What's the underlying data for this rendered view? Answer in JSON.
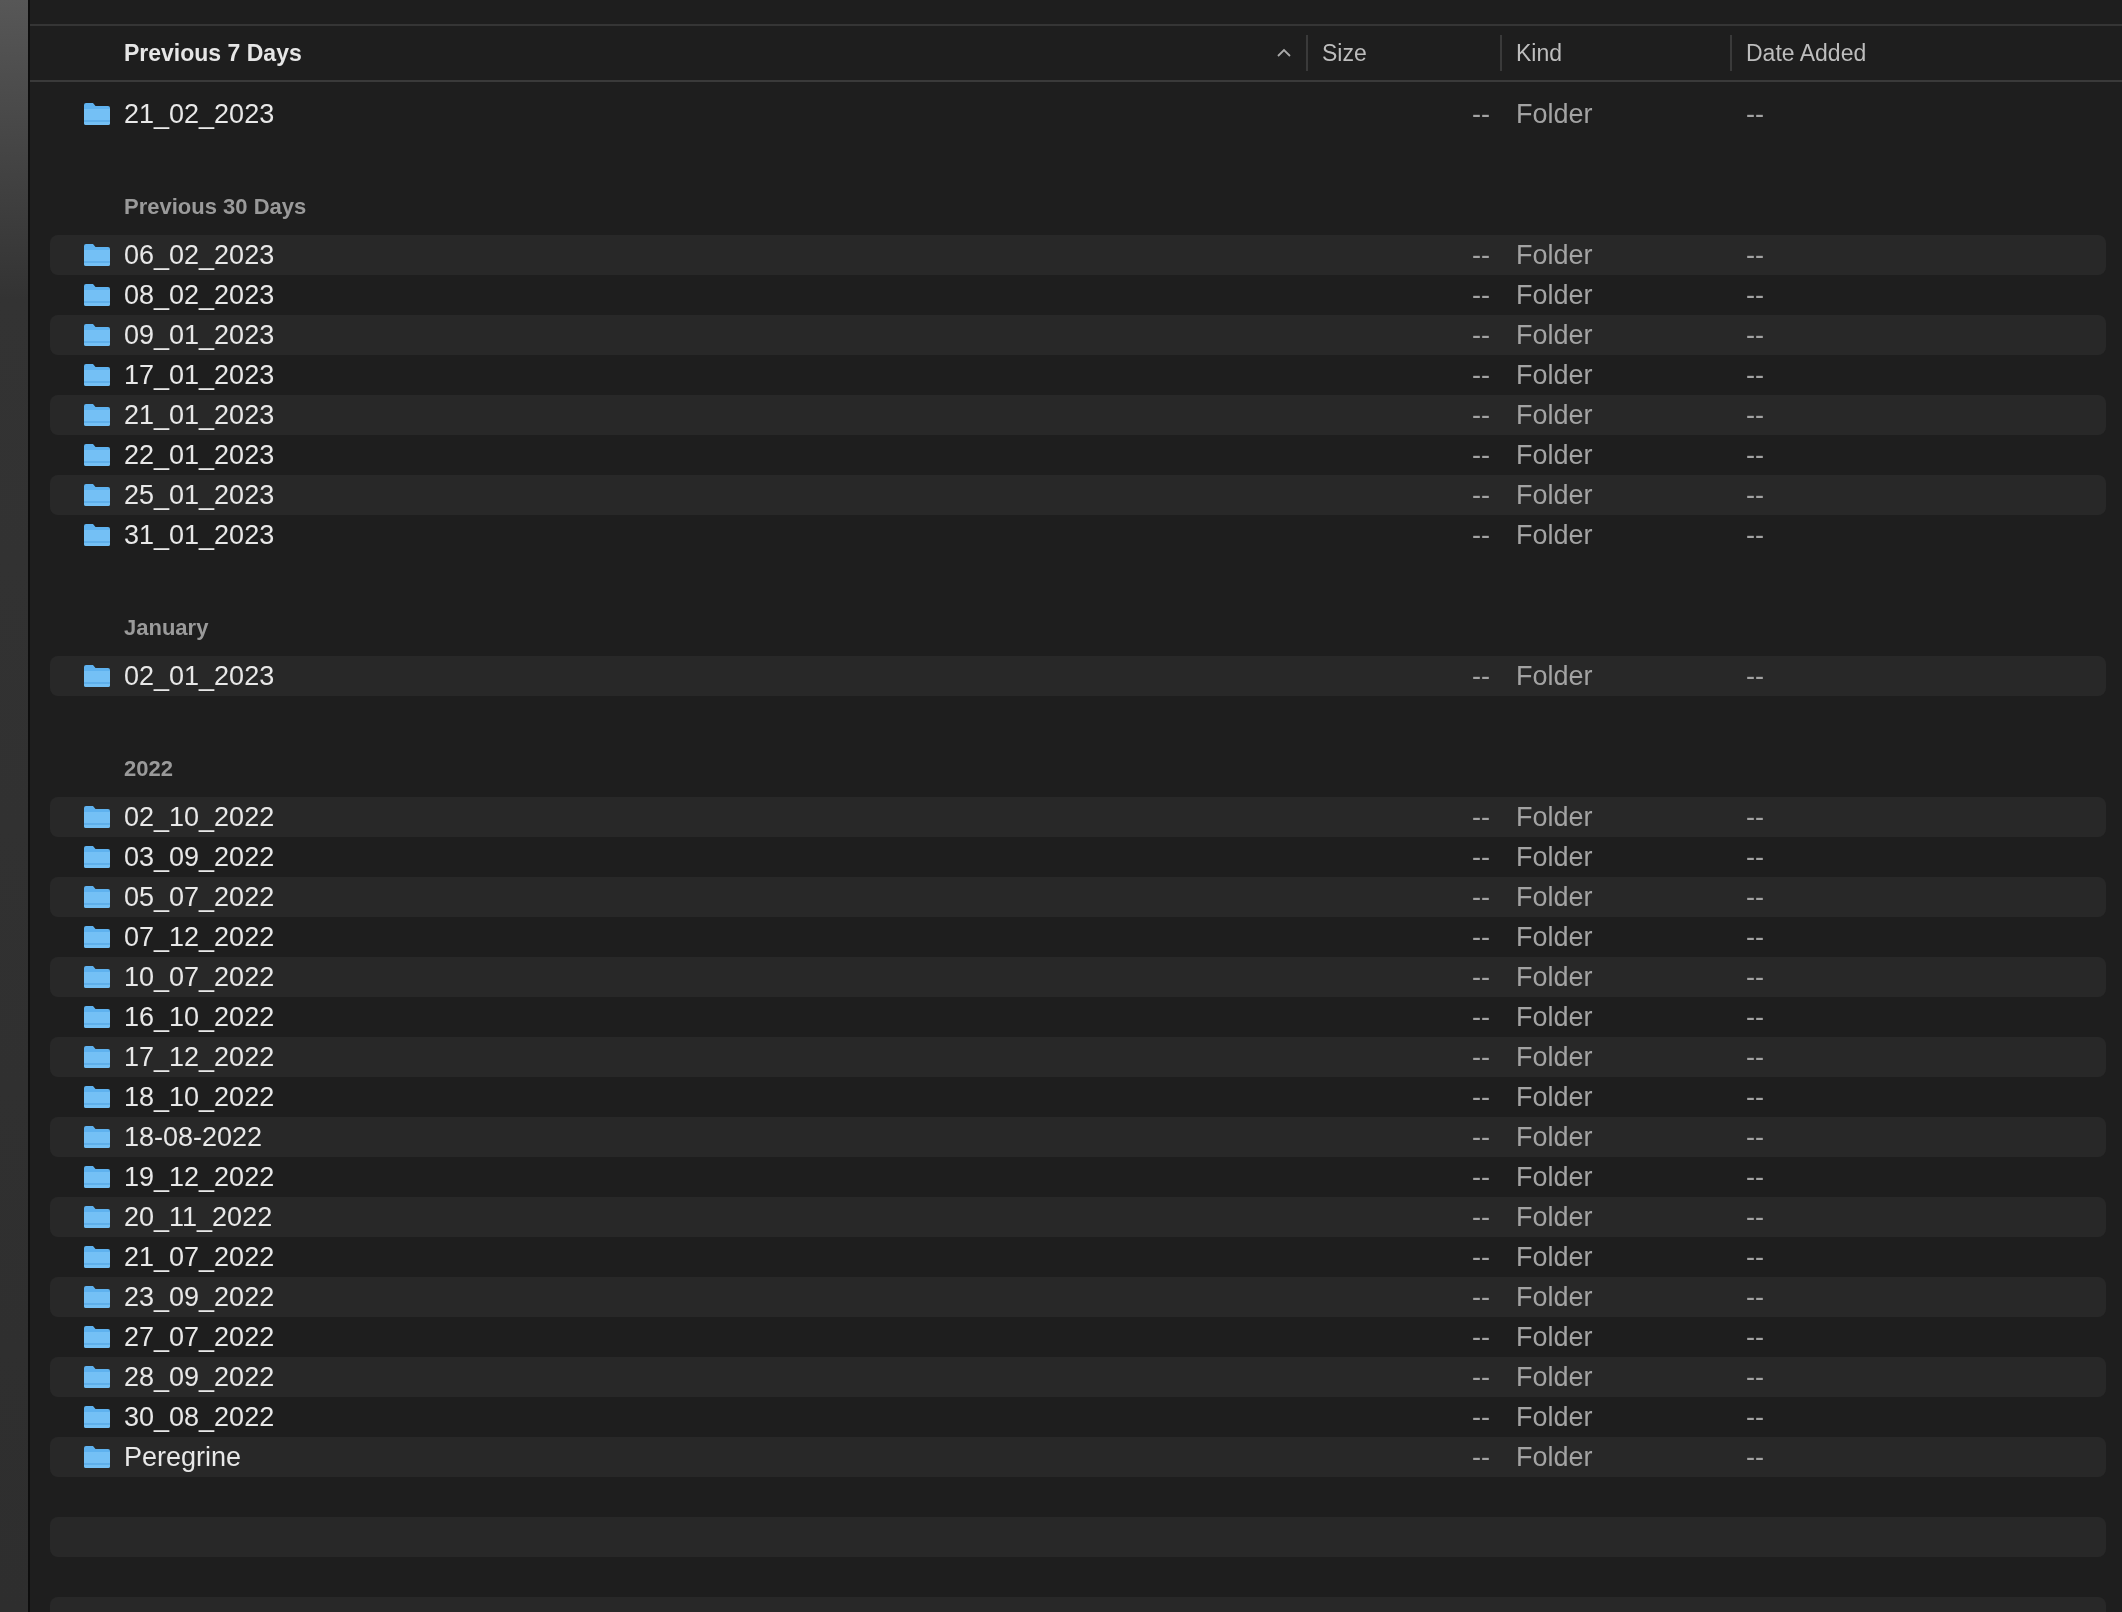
{
  "table": {
    "columns": [
      {
        "label": "Previous 7 Days",
        "sorted": true
      },
      {
        "label": "Size",
        "sorted": false
      },
      {
        "label": "Kind",
        "sorted": false
      },
      {
        "label": "Date Added",
        "sorted": false
      }
    ],
    "sections": [
      {
        "rows": [
          {
            "name": "21_02_2023",
            "size": "--",
            "kind": "Folder",
            "date_added": "--"
          }
        ]
      },
      {
        "title": "Previous 30 Days",
        "rows": [
          {
            "name": "06_02_2023",
            "size": "--",
            "kind": "Folder",
            "date_added": "--"
          },
          {
            "name": "08_02_2023",
            "size": "--",
            "kind": "Folder",
            "date_added": "--"
          },
          {
            "name": "09_01_2023",
            "size": "--",
            "kind": "Folder",
            "date_added": "--"
          },
          {
            "name": "17_01_2023",
            "size": "--",
            "kind": "Folder",
            "date_added": "--"
          },
          {
            "name": "21_01_2023",
            "size": "--",
            "kind": "Folder",
            "date_added": "--"
          },
          {
            "name": "22_01_2023",
            "size": "--",
            "kind": "Folder",
            "date_added": "--"
          },
          {
            "name": "25_01_2023",
            "size": "--",
            "kind": "Folder",
            "date_added": "--"
          },
          {
            "name": "31_01_2023",
            "size": "--",
            "kind": "Folder",
            "date_added": "--"
          }
        ]
      },
      {
        "title": "January",
        "rows": [
          {
            "name": "02_01_2023",
            "size": "--",
            "kind": "Folder",
            "date_added": "--"
          }
        ]
      },
      {
        "title": "2022",
        "rows": [
          {
            "name": "02_10_2022",
            "size": "--",
            "kind": "Folder",
            "date_added": "--"
          },
          {
            "name": "03_09_2022",
            "size": "--",
            "kind": "Folder",
            "date_added": "--"
          },
          {
            "name": "05_07_2022",
            "size": "--",
            "kind": "Folder",
            "date_added": "--"
          },
          {
            "name": "07_12_2022",
            "size": "--",
            "kind": "Folder",
            "date_added": "--"
          },
          {
            "name": "10_07_2022",
            "size": "--",
            "kind": "Folder",
            "date_added": "--"
          },
          {
            "name": "16_10_2022",
            "size": "--",
            "kind": "Folder",
            "date_added": "--"
          },
          {
            "name": "17_12_2022",
            "size": "--",
            "kind": "Folder",
            "date_added": "--"
          },
          {
            "name": "18_10_2022",
            "size": "--",
            "kind": "Folder",
            "date_added": "--"
          },
          {
            "name": "18-08-2022",
            "size": "--",
            "kind": "Folder",
            "date_added": "--"
          },
          {
            "name": "19_12_2022",
            "size": "--",
            "kind": "Folder",
            "date_added": "--"
          },
          {
            "name": "20_11_2022",
            "size": "--",
            "kind": "Folder",
            "date_added": "--"
          },
          {
            "name": "21_07_2022",
            "size": "--",
            "kind": "Folder",
            "date_added": "--"
          },
          {
            "name": "23_09_2022",
            "size": "--",
            "kind": "Folder",
            "date_added": "--"
          },
          {
            "name": "27_07_2022",
            "size": "--",
            "kind": "Folder",
            "date_added": "--"
          },
          {
            "name": "28_09_2022",
            "size": "--",
            "kind": "Folder",
            "date_added": "--"
          },
          {
            "name": "30_08_2022",
            "size": "--",
            "kind": "Folder",
            "date_added": "--"
          },
          {
            "name": "Peregrine",
            "size": "--",
            "kind": "Folder",
            "date_added": "--"
          }
        ]
      }
    ]
  }
}
